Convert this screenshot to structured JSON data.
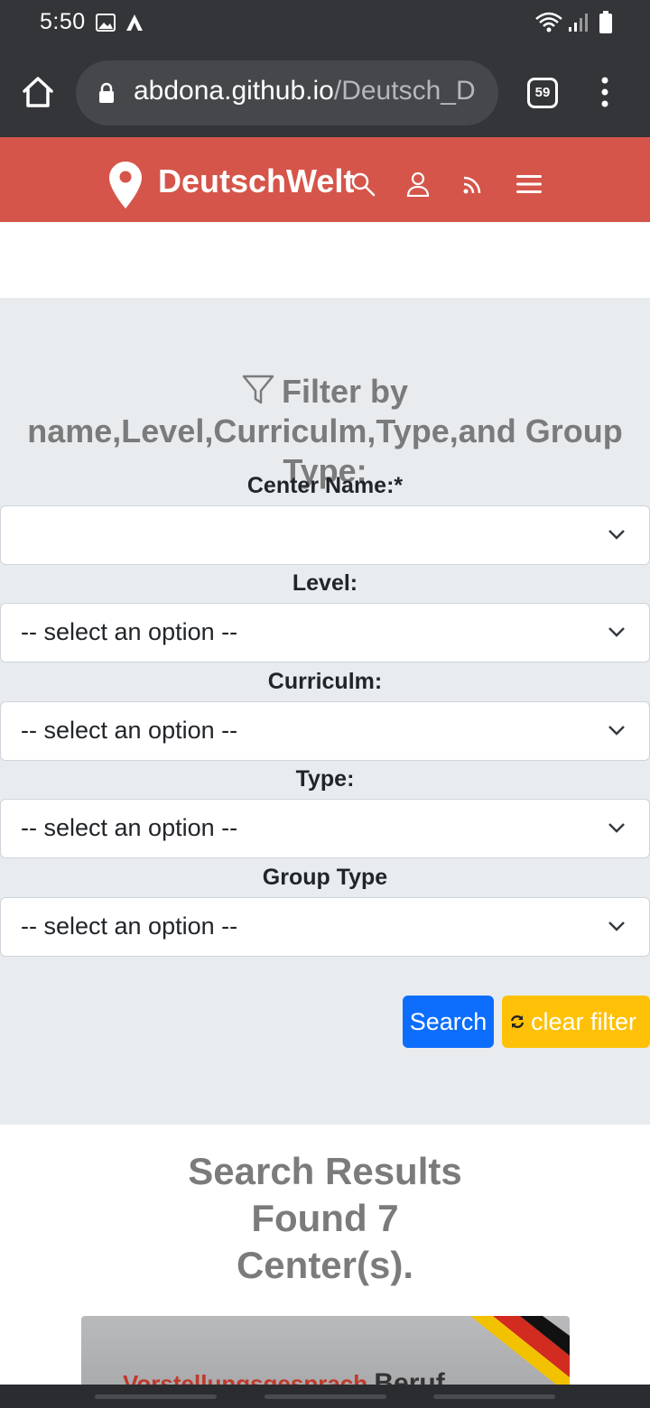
{
  "status_bar": {
    "time": "5:50"
  },
  "browser": {
    "url_host": "abdona.github.io",
    "url_path": "/Deutsch_D",
    "tab_count": "59"
  },
  "site": {
    "brand": "DeutschWelt"
  },
  "filter": {
    "heading": "Filter by name,Level,Curriculm,Type,and Group Type:",
    "fields": [
      {
        "label": "Center Name:*",
        "value": ""
      },
      {
        "label": "Level:",
        "value": "-- select an option --"
      },
      {
        "label": "Curriculm:",
        "value": "-- select an option --"
      },
      {
        "label": "Type:",
        "value": "-- select an option --"
      },
      {
        "label": "Group Type",
        "value": "-- select an option --"
      }
    ],
    "search_label": "Search",
    "clear_label": "clear filter"
  },
  "results": {
    "line1": "Search Results",
    "line2": "Found 7",
    "line3": "Center(s).",
    "card_text_red": "Vorstellungsgesprach",
    "card_text_dark": "Beruf"
  },
  "colors": {
    "header": "#d5554a",
    "search_button": "#0d6efd",
    "clear_button": "#ffc107",
    "filter_bg": "#e9ecef"
  }
}
